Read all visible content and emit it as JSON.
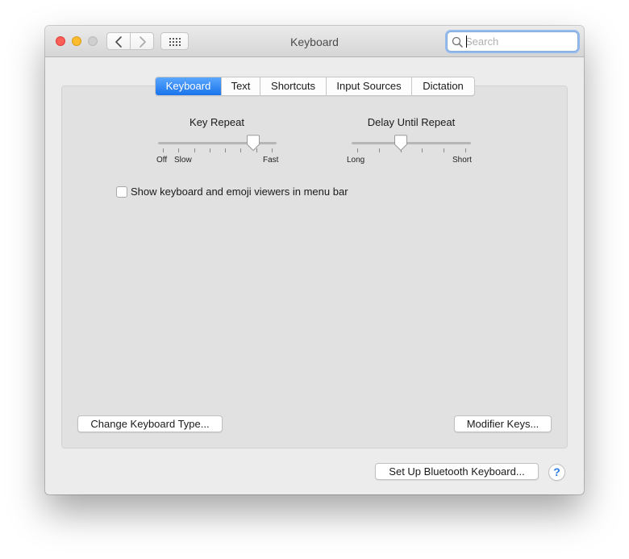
{
  "window": {
    "title": "Keyboard"
  },
  "toolbar": {
    "back_icon": "chevron-left-icon",
    "forward_icon": "chevron-right-icon",
    "show_all_icon": "grid-icon",
    "search": {
      "placeholder": "Search",
      "value": ""
    }
  },
  "tabs": [
    {
      "label": "Keyboard",
      "selected": true
    },
    {
      "label": "Text",
      "selected": false
    },
    {
      "label": "Shortcuts",
      "selected": false
    },
    {
      "label": "Input Sources",
      "selected": false
    },
    {
      "label": "Dictation",
      "selected": false
    }
  ],
  "key_repeat": {
    "label": "Key Repeat",
    "min_label_1": "Off",
    "min_label_2": "Slow",
    "max_label": "Fast",
    "ticks": 8,
    "value_fraction": 0.83
  },
  "delay_until_repeat": {
    "label": "Delay Until Repeat",
    "min_label": "Long",
    "max_label": "Short",
    "ticks": 6,
    "value_fraction": 0.4
  },
  "menu_bar_option": {
    "label": "Show keyboard and emoji viewers in menu bar",
    "checked": false
  },
  "buttons": {
    "change_keyboard_type": "Change Keyboard Type...",
    "modifier_keys": "Modifier Keys...",
    "bluetooth_keyboard": "Set Up Bluetooth Keyboard...",
    "help": "?"
  },
  "colors": {
    "accent": "#1a73ec",
    "close": "#fc5f57",
    "minimize": "#fdbc2e",
    "zoom_disabled": "#cfcfcf"
  }
}
